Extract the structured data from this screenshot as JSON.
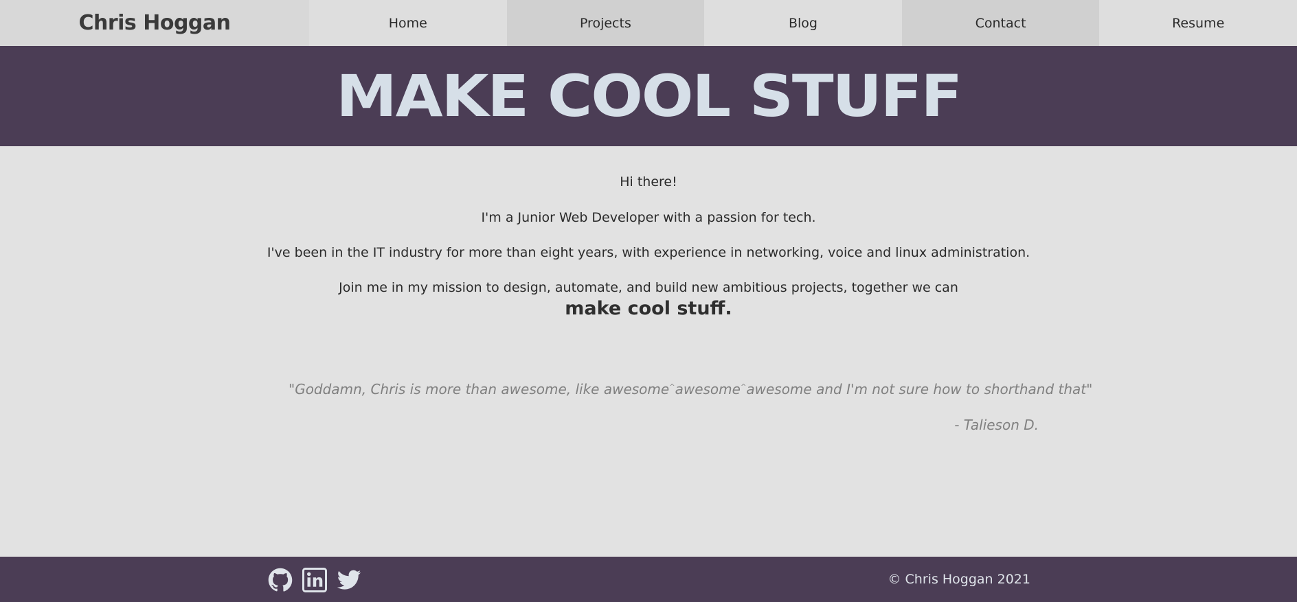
{
  "nav": {
    "brand": "Chris Hoggan",
    "items": [
      {
        "label": "Home"
      },
      {
        "label": "Projects"
      },
      {
        "label": "Blog"
      },
      {
        "label": "Contact"
      },
      {
        "label": "Resume"
      }
    ]
  },
  "hero": {
    "title": "MAKE COOL STUFF"
  },
  "main": {
    "greeting": "Hi there!",
    "intro": "I'm a Junior Web Developer with a passion for tech.",
    "experience": "I've been in the IT industry for more than eight years, with experience in networking, voice and linux administration.",
    "mission": "Join me in my mission to design, automate, and build new ambitious projects, together we can",
    "tagline": "make cool stuff.",
    "quote_part1": "\"Goddamn, Chris is more than awesome, like awesome",
    "quote_caret": "^",
    "quote_part2": "awesome",
    "quote_part3": "awesome and I'm not sure how to shorthand that\"",
    "quote_author": "- Talieson D."
  },
  "footer": {
    "icons": [
      "github-icon",
      "linkedin-icon",
      "twitter-icon"
    ],
    "copyright": "© Chris Hoggan 2021"
  },
  "colors": {
    "accent": "#4b3d55",
    "hero_text": "#d6dfe8",
    "background": "#e2e2e2"
  }
}
